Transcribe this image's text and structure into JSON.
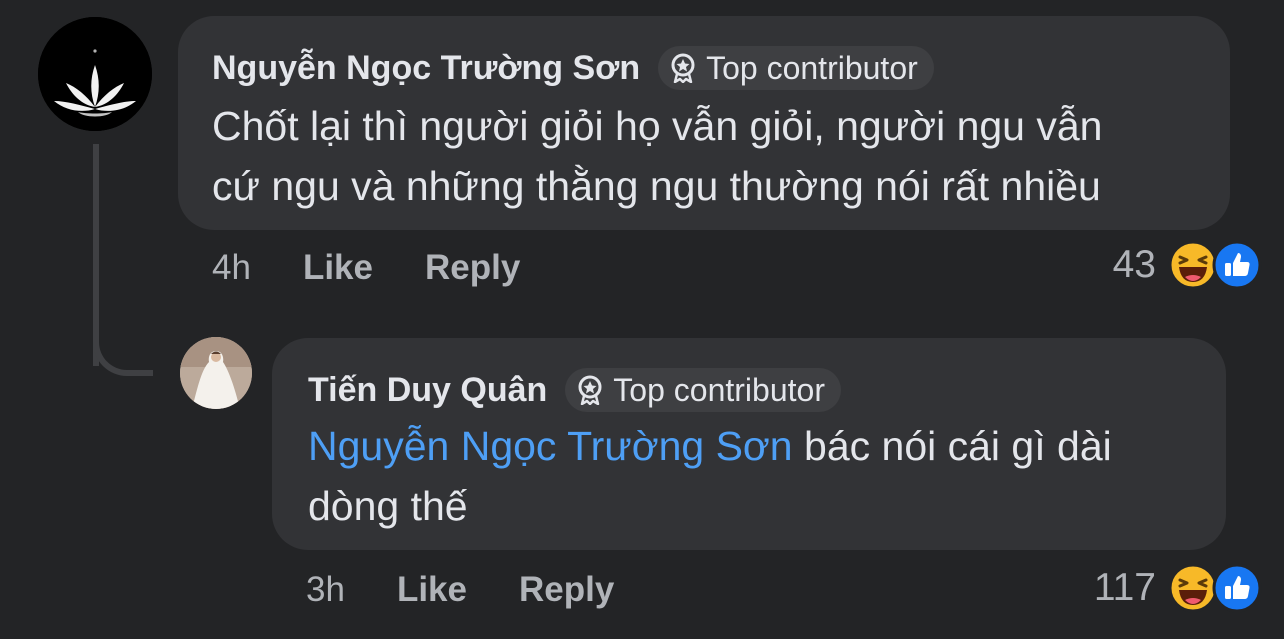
{
  "comments": [
    {
      "author": "Nguyễn Ngọc Trường Sơn",
      "badge": "Top contributor",
      "text_line1": "Chốt lại thì người giỏi họ vẫn giỏi, người ngu vẫn",
      "text_line2": "cứ ngu và những thằng ngu thường nói rất nhiều",
      "time": "4h",
      "like_label": "Like",
      "reply_label": "Reply",
      "reaction_count": "43",
      "reactions": [
        "haha-icon",
        "like-icon"
      ]
    },
    {
      "author": "Tiến Duy Quân",
      "badge": "Top contributor",
      "mention": "Nguyễn Ngọc Trường Sơn",
      "text_after_mention": "bác nói cái gì dài",
      "text_line2": "dòng thế",
      "time": "3h",
      "like_label": "Like",
      "reply_label": "Reply",
      "reaction_count": "117",
      "reactions": [
        "haha-icon",
        "like-icon"
      ]
    }
  ],
  "colors": {
    "background": "#232426",
    "bubble": "#323336",
    "text": "#e4e6eb",
    "secondary_text": "#b0b3b8",
    "mention": "#4e9ff5",
    "like_blue": "#1877f2",
    "haha_yellow": "#f7b928"
  }
}
